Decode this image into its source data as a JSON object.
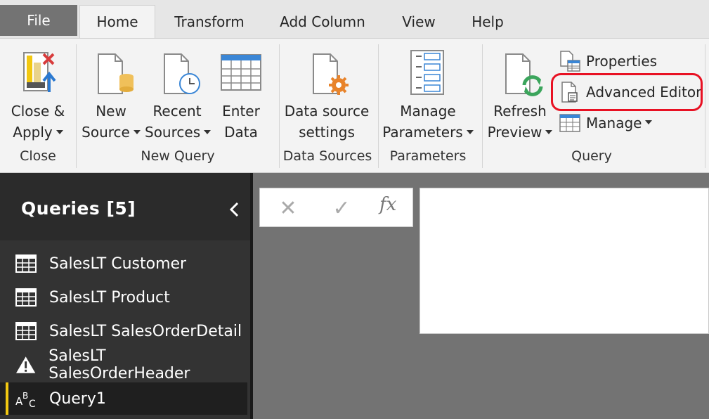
{
  "tabs": {
    "file": "File",
    "home": "Home",
    "transform": "Transform",
    "add_column": "Add Column",
    "view": "View",
    "help": "Help"
  },
  "ribbon": {
    "close_apply": {
      "line1": "Close &",
      "line2": "Apply",
      "icon": "close-apply-icon"
    },
    "new_source": {
      "line1": "New",
      "line2": "Source",
      "icon": "new-source-icon"
    },
    "recent_sources": {
      "line1": "Recent",
      "line2": "Sources",
      "icon": "recent-sources-icon"
    },
    "enter_data": {
      "line1": "Enter",
      "line2": "Data",
      "icon": "table-icon"
    },
    "data_source_settings": {
      "line1": "Data source",
      "line2": "settings",
      "icon": "data-source-settings-icon"
    },
    "manage_parameters": {
      "line1": "Manage",
      "line2": "Parameters",
      "icon": "parameters-icon"
    },
    "refresh_preview": {
      "line1": "Refresh",
      "line2": "Preview",
      "icon": "refresh-icon"
    },
    "properties": {
      "label": "Properties",
      "icon": "properties-icon"
    },
    "advanced_editor": {
      "label": "Advanced Editor",
      "icon": "advanced-editor-icon"
    },
    "manage": {
      "label": "Manage",
      "icon": "manage-icon"
    },
    "groups": {
      "close": "Close",
      "new_query": "New Query",
      "data_sources": "Data Sources",
      "parameters": "Parameters",
      "query": "Query"
    },
    "highlight_color": "#e81123"
  },
  "sidebar": {
    "title": "Queries [5]",
    "items": [
      {
        "label": "SalesLT Customer",
        "icon": "table-icon"
      },
      {
        "label": "SalesLT Product",
        "icon": "table-icon"
      },
      {
        "label": "SalesLT SalesOrderDetail",
        "icon": "table-icon"
      },
      {
        "label": "SalesLT SalesOrderHeader",
        "icon": "warning-icon"
      },
      {
        "label": "Query1",
        "icon": "text-type-icon",
        "selected": true
      }
    ],
    "accent": "#f2c811"
  },
  "formula_bar": {
    "cancel": "✕",
    "confirm": "✓",
    "fx": "fx"
  }
}
